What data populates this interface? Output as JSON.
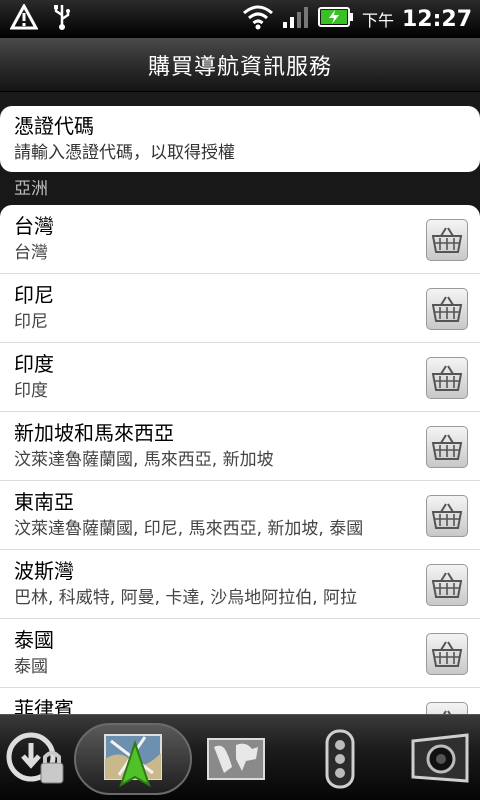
{
  "status_bar": {
    "ampm": "下午",
    "time": "12:27",
    "icons": [
      "warning-icon",
      "usb-icon",
      "wifi-icon",
      "signal-icon",
      "battery-charging-icon"
    ]
  },
  "header": {
    "title": "購買導航資訊服務"
  },
  "credential": {
    "title": "憑證代碼",
    "subtitle": "請輸入憑證代碼，以取得授權"
  },
  "section": {
    "label": "亞洲"
  },
  "regions": [
    {
      "name": "台灣",
      "countries": "台灣"
    },
    {
      "name": "印尼",
      "countries": "印尼"
    },
    {
      "name": "印度",
      "countries": "印度"
    },
    {
      "name": "新加坡和馬來西亞",
      "countries": "汶萊達魯薩蘭國, 馬來西亞, 新加坡"
    },
    {
      "name": "東南亞",
      "countries": "汶萊達魯薩蘭國, 印尼, 馬來西亞, 新加坡, 泰國"
    },
    {
      "name": "波斯灣",
      "countries": "巴林, 科威特, 阿曼, 卡達, 沙烏地阿拉伯, 阿拉"
    },
    {
      "name": "泰國",
      "countries": "泰國"
    },
    {
      "name": "菲律賓",
      "countries": ""
    }
  ],
  "dock": {
    "items": [
      "lock-icon",
      "navigation-map-icon",
      "world-map-icon",
      "traffic-light-icon",
      "camera-icon"
    ]
  }
}
